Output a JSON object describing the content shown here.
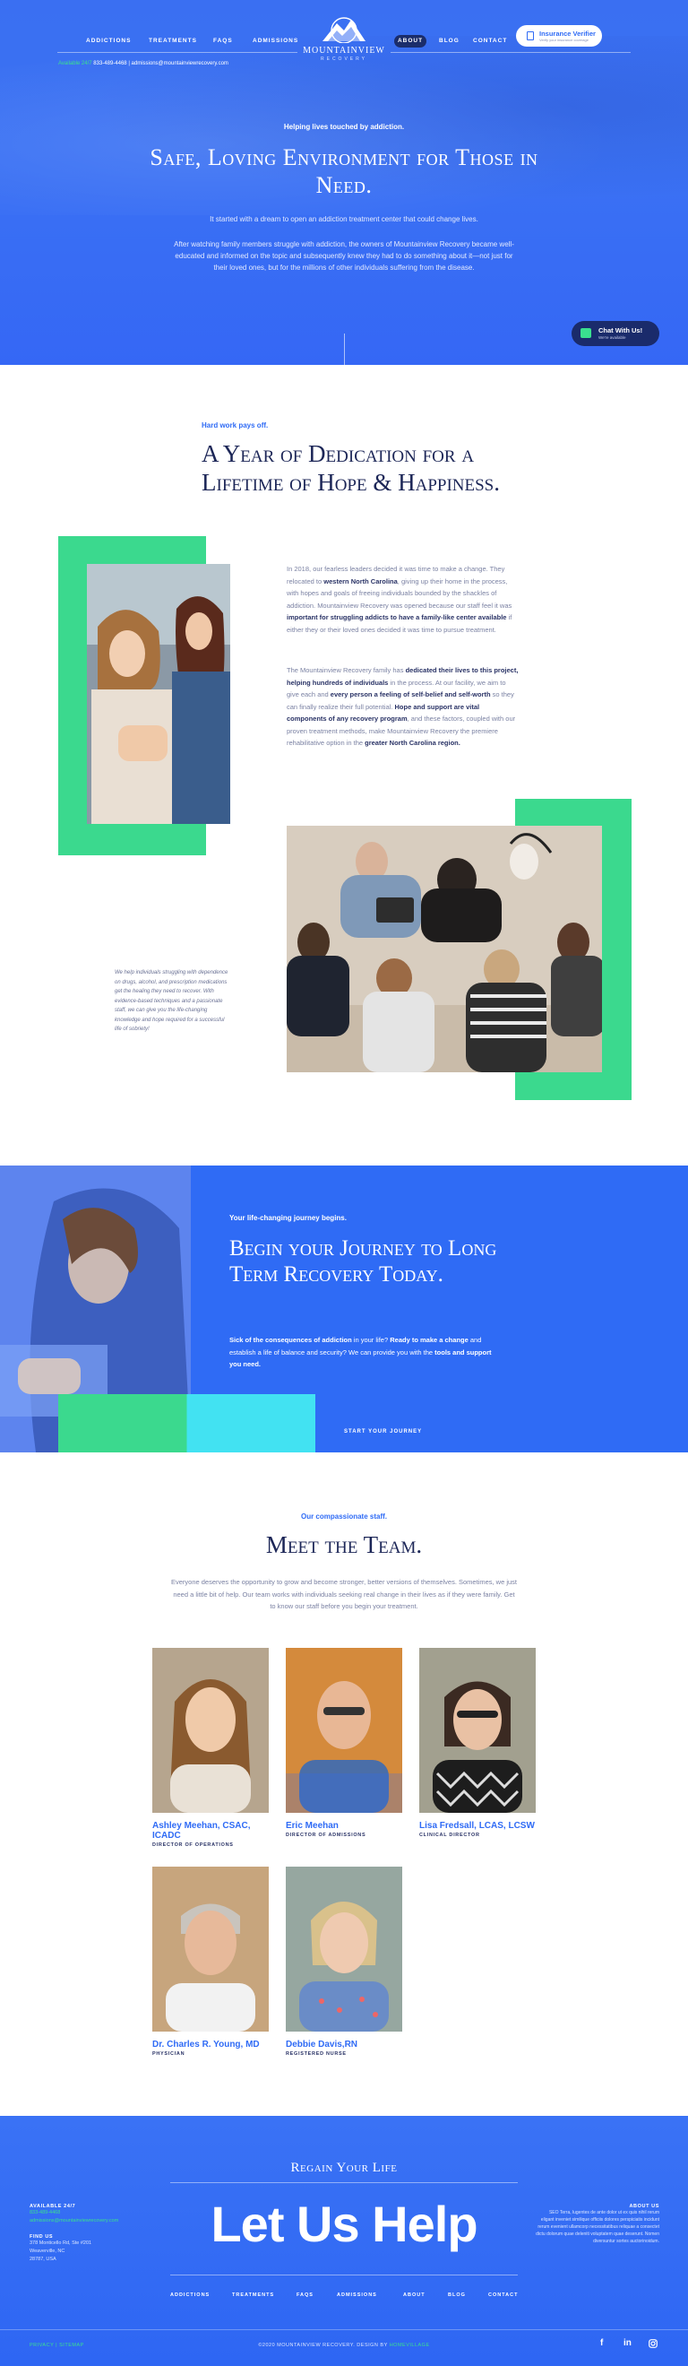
{
  "nav": {
    "left": [
      "ADDICTIONS",
      "TREATMENTS",
      "FAQS",
      "ADMISSIONS"
    ],
    "right": [
      "ABOUT",
      "BLOG",
      "CONTACT"
    ],
    "logo_name": "MOUNTAINVIEW",
    "logo_sub": "RECOVERY",
    "insurance_title": "Insurance Verifier",
    "insurance_sub": "Verify your insurance coverage",
    "available_label": "Available 24/7",
    "phone": "833-489-4468",
    "email": "admissions@mountainviewrecovery.com"
  },
  "hero": {
    "kicker": "Helping lives touched by addiction.",
    "title": "Safe, Loving Environment for Those in Need.",
    "p1": "It started with a dream to open an addiction treatment center that could change lives.",
    "p2": "After watching family members struggle with addiction, the owners of Mountainview Recovery became well-educated and informed on the topic and subsequently knew they had to do something about it—not just for their loved ones, but for the millions of other individuals suffering from the disease.",
    "chat_title": "Chat With Us!",
    "chat_sub": "We're available"
  },
  "dedication": {
    "kicker": "Hard work pays off.",
    "title": "A Year of Dedication for a Lifetime of Hope & Happiness.",
    "p1_a": "In 2018, our fearless leaders decided it was time to make a change. They relocated to ",
    "p1_b": "western North Carolina",
    "p1_c": ", giving up their home in the process, with hopes and goals of freeing individuals bounded by the shackles of addiction. Mountainview Recovery was opened because our staff feel it was ",
    "p1_d": "important for struggling addicts to have a family-like center available",
    "p1_e": " if either they or their loved ones decided it was time to pursue treatment.",
    "p2_a": "The Mountainview Recovery family has ",
    "p2_b": "dedicated their lives to this project, helping hundreds of individuals",
    "p2_c": " in the process. At our facility, we aim to give each and ",
    "p2_d": "every person a feeling of self-belief and self-worth",
    "p2_e": " so they can finally realize their full potential. ",
    "p2_f": "Hope and support are vital components of any recovery program",
    "p2_g": ", and these factors, coupled with our proven treatment methods, make Mountainview Recovery the premiere rehabilitative option in the ",
    "p2_h": "greater North Carolina region.",
    "quote": "We help individuals struggling with dependence on drugs, alcohol, and prescription medications get the healing they need to recover. With evidence-based techniques and a passionate staff, we can give you the life-changing knowledge and hope required for a successful life of sobriety!"
  },
  "journey": {
    "kicker": "Your life-changing journey begins.",
    "title": "Begin your Journey to Long Term Recovery Today.",
    "p_a": "Sick of the consequences of addiction",
    "p_b": " in your life? ",
    "p_c": "Ready to make a change",
    "p_d": " and establish a life of balance and security? We can provide you with the ",
    "p_e": "tools and support you need.",
    "cta": "START YOUR JOURNEY"
  },
  "team": {
    "kicker": "Our compassionate staff.",
    "title": "Meet the Team.",
    "intro": "Everyone deserves the opportunity to grow and become stronger, better versions of themselves. Sometimes, we just need a little bit of help. Our team works with individuals seeking real change in their lives as if they were family. Get to know our staff before you begin your treatment.",
    "members": [
      {
        "name": "Ashley Meehan, CSAC, ICADC",
        "role": "DIRECTOR OF OPERATIONS"
      },
      {
        "name": "Eric Meehan",
        "role": "DIRECTOR OF ADMISSIONS"
      },
      {
        "name": "Lisa Fredsall, LCAS, LCSW",
        "role": "CLINICAL DIRECTOR"
      },
      {
        "name": "Dr. Charles R. Young, MD",
        "role": "PHYSICIAN"
      },
      {
        "name": "Debbie Davis,RN",
        "role": "REGISTERED NURSE"
      }
    ]
  },
  "footer": {
    "regain": "Regain Your Life",
    "big": "Let Us Help",
    "available_h": "AVAILABLE 24/7",
    "phone": "833-489-4468",
    "email": "admissions@mountainviewrecovery.com",
    "find_h": "FIND US",
    "addr1": "378 Monticello Rd, Ste #201",
    "addr2": "Weaverville, NC",
    "addr3": "28787, USA",
    "about_h": "ABOUT US",
    "about_t": "SEO Terra, lugentes de ante dolor ut ex quis nihil rerum eligant inveniet similique officiis dolores perspiciatis incidunt rerum evenient ullamcorp necessitatibus reliquae a consectet dictu dolorum quae deleniti voluptatem quae deserunt. Nomen diversuntur sortes auctorinoidum.",
    "nav": [
      "ADDICTIONS",
      "TREATMENTS",
      "FAQS",
      "ADMISSIONS",
      "ABOUT",
      "BLOG",
      "CONTACT"
    ],
    "privacy": "PRIVACY",
    "sitemap": "SITEMAP",
    "copy": "©2020 MOUNTAINVIEW RECOVERY. DESIGN BY ",
    "designer": "HOMEVILLAGE"
  },
  "colors": {
    "primary_blue": "#2f6bf5",
    "green": "#3bd98e",
    "navy": "#1c2657",
    "teal": "#42e2f2"
  }
}
